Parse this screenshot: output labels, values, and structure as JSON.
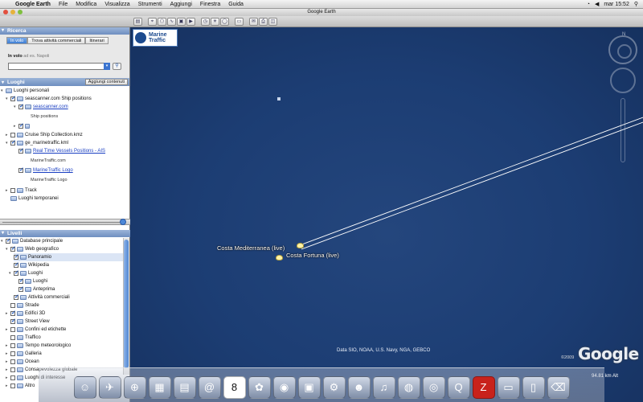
{
  "menubar": {
    "app_name": "Google Earth",
    "items": [
      "File",
      "Modifica",
      "Visualizza",
      "Strumenti",
      "Aggiungi",
      "Finestra",
      "Guida"
    ],
    "clock": "mar 15:52"
  },
  "window": {
    "title": "Google Earth"
  },
  "search": {
    "header": "Ricerca",
    "tabs": [
      "In volo",
      "Trova attività commerciali",
      "Itinerari"
    ],
    "active_tab": "In volo",
    "label": "In volo",
    "hint": "ad es. Napoli"
  },
  "places": {
    "header": "Luoghi",
    "add_button": "Aggiungi contenuti",
    "items": [
      {
        "label": "Luoghi personali"
      },
      {
        "label": "seascanner.com Ship positions"
      },
      {
        "label": "seascanner.com"
      },
      {
        "label": "Ship positions"
      },
      {
        "label": "Cruise Ship Collection.kmz"
      },
      {
        "label": "ge_marinetraffic.kml"
      },
      {
        "label": "Real Time Vessels Positions - AIS"
      },
      {
        "label": "MarineTraffic.com"
      },
      {
        "label": "MarineTraffic Logo"
      },
      {
        "label": "MarineTraffic Logo"
      },
      {
        "label": "Track"
      },
      {
        "label": "Luoghi temporanei"
      }
    ]
  },
  "layers": {
    "header": "Livelli",
    "items": [
      {
        "label": "Database principale"
      },
      {
        "label": "Web geografico"
      },
      {
        "label": "Panoramio"
      },
      {
        "label": "Wikipedia"
      },
      {
        "label": "Luoghi"
      },
      {
        "label": "Luoghi"
      },
      {
        "label": "Anteprima"
      },
      {
        "label": "Attività commerciali"
      },
      {
        "label": "Strade"
      },
      {
        "label": "Edifici 3D"
      },
      {
        "label": "Street View"
      },
      {
        "label": "Confini ed etichette"
      },
      {
        "label": "Traffico"
      },
      {
        "label": "Tempo meteorologico"
      },
      {
        "label": "Galleria"
      },
      {
        "label": "Ocean"
      },
      {
        "label": "Consapevolezza globale"
      },
      {
        "label": "Luoghi di interesse"
      },
      {
        "label": "Altro"
      }
    ]
  },
  "map": {
    "logo": {
      "line1": "Marine",
      "line2": "Traffic"
    },
    "compass_letter": "N",
    "ships": [
      {
        "label": "Costa Mediterranea (live)"
      },
      {
        "label": "Costa Fortuna (live)"
      }
    ],
    "credit": "Data SIO, NOAA, U.S. Navy, NGA, GEBCO",
    "copyright": "©2009",
    "logo_text": "Google",
    "altitude": "94.81 km Alt"
  },
  "toolbar": {
    "icons": [
      "sidebar-icon",
      "placemark-icon",
      "polygon-icon",
      "path-icon",
      "overlay-icon",
      "tour-icon",
      "historical-imagery-icon",
      "sun-icon",
      "planets-icon",
      "ruler-icon",
      "email-icon",
      "print-icon",
      "maps-icon"
    ]
  },
  "dock": {
    "icons": [
      "finder-icon",
      "mail-icon",
      "safari-icon",
      "calculator-icon",
      "preview-icon",
      "address-book-icon",
      "ical-icon",
      "iphoto-icon",
      "photo-booth-icon",
      "expose-icon",
      "system-preferences-icon",
      "ichat-icon",
      "itunes-icon",
      "google-earth-icon",
      "activity-monitor-icon",
      "quicktime-icon",
      "filezilla-icon",
      "folder-icon",
      "document-icon",
      "trash-icon"
    ],
    "ical_day": "8"
  }
}
